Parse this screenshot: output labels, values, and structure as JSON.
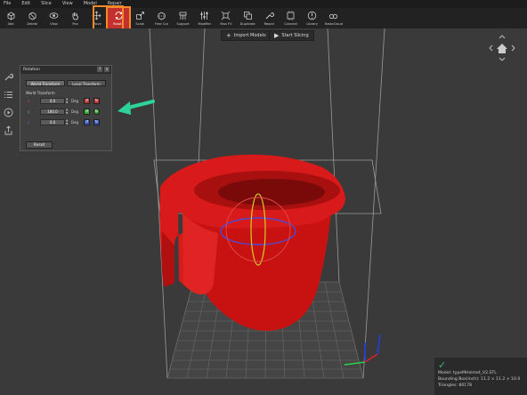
{
  "menubar": {
    "items": [
      "File",
      "Edit",
      "Slice",
      "View",
      "Model",
      "Repair"
    ]
  },
  "toolbar": {
    "tools": [
      {
        "label": "Add",
        "icon": "add-icon"
      },
      {
        "label": "Delete",
        "icon": "delete-icon"
      },
      {
        "label": "View",
        "icon": "view-icon"
      },
      {
        "label": "Pan",
        "icon": "pan-icon"
      },
      {
        "label": "Move",
        "icon": "move-icon"
      },
      {
        "label": "Rotate",
        "icon": "rotate-icon",
        "active": true
      },
      {
        "label": "Scale",
        "icon": "scale-icon"
      },
      {
        "label": "Free Cut",
        "icon": "cut-icon"
      },
      {
        "label": "Support",
        "icon": "support-icon"
      },
      {
        "label": "Modifier",
        "icon": "modifier-icon"
      },
      {
        "label": "Max FV",
        "icon": "maxfv-icon"
      },
      {
        "label": "Duplicate",
        "icon": "duplicate-icon"
      },
      {
        "label": "Repair",
        "icon": "repair-icon"
      },
      {
        "label": "Connect",
        "icon": "connect-icon"
      },
      {
        "label": "Library",
        "icon": "library-icon"
      },
      {
        "label": "RaiseCloud",
        "icon": "cloud-icon"
      }
    ],
    "active_color": "#c4302b",
    "highlight_color": "#f08a2b"
  },
  "top_buttons": {
    "import_label": "Import Models",
    "slice_label": "Start Slicing"
  },
  "rotation_panel": {
    "title": "Rotation",
    "tab_world": "World Transform",
    "tab_local": "Local Transform",
    "group_label": "World Transform",
    "rows": [
      {
        "axis": "x",
        "value": "0.0",
        "unit": "Deg"
      },
      {
        "axis": "y",
        "value": "180.0",
        "unit": "Deg"
      },
      {
        "axis": "z",
        "value": "0.0",
        "unit": "Deg"
      }
    ],
    "reset_label": "Reset"
  },
  "model_info": {
    "model": "Model: typeMHelmet_V2.STL",
    "bounding_box": "Bounding Box(inch): 11.2 × 11.2 × 10.0",
    "triangles": "Triangles: 80178"
  },
  "colors": {
    "model": "#d41a1a",
    "arrow": "#2ed39a",
    "status_ok": "#3ab36a"
  }
}
